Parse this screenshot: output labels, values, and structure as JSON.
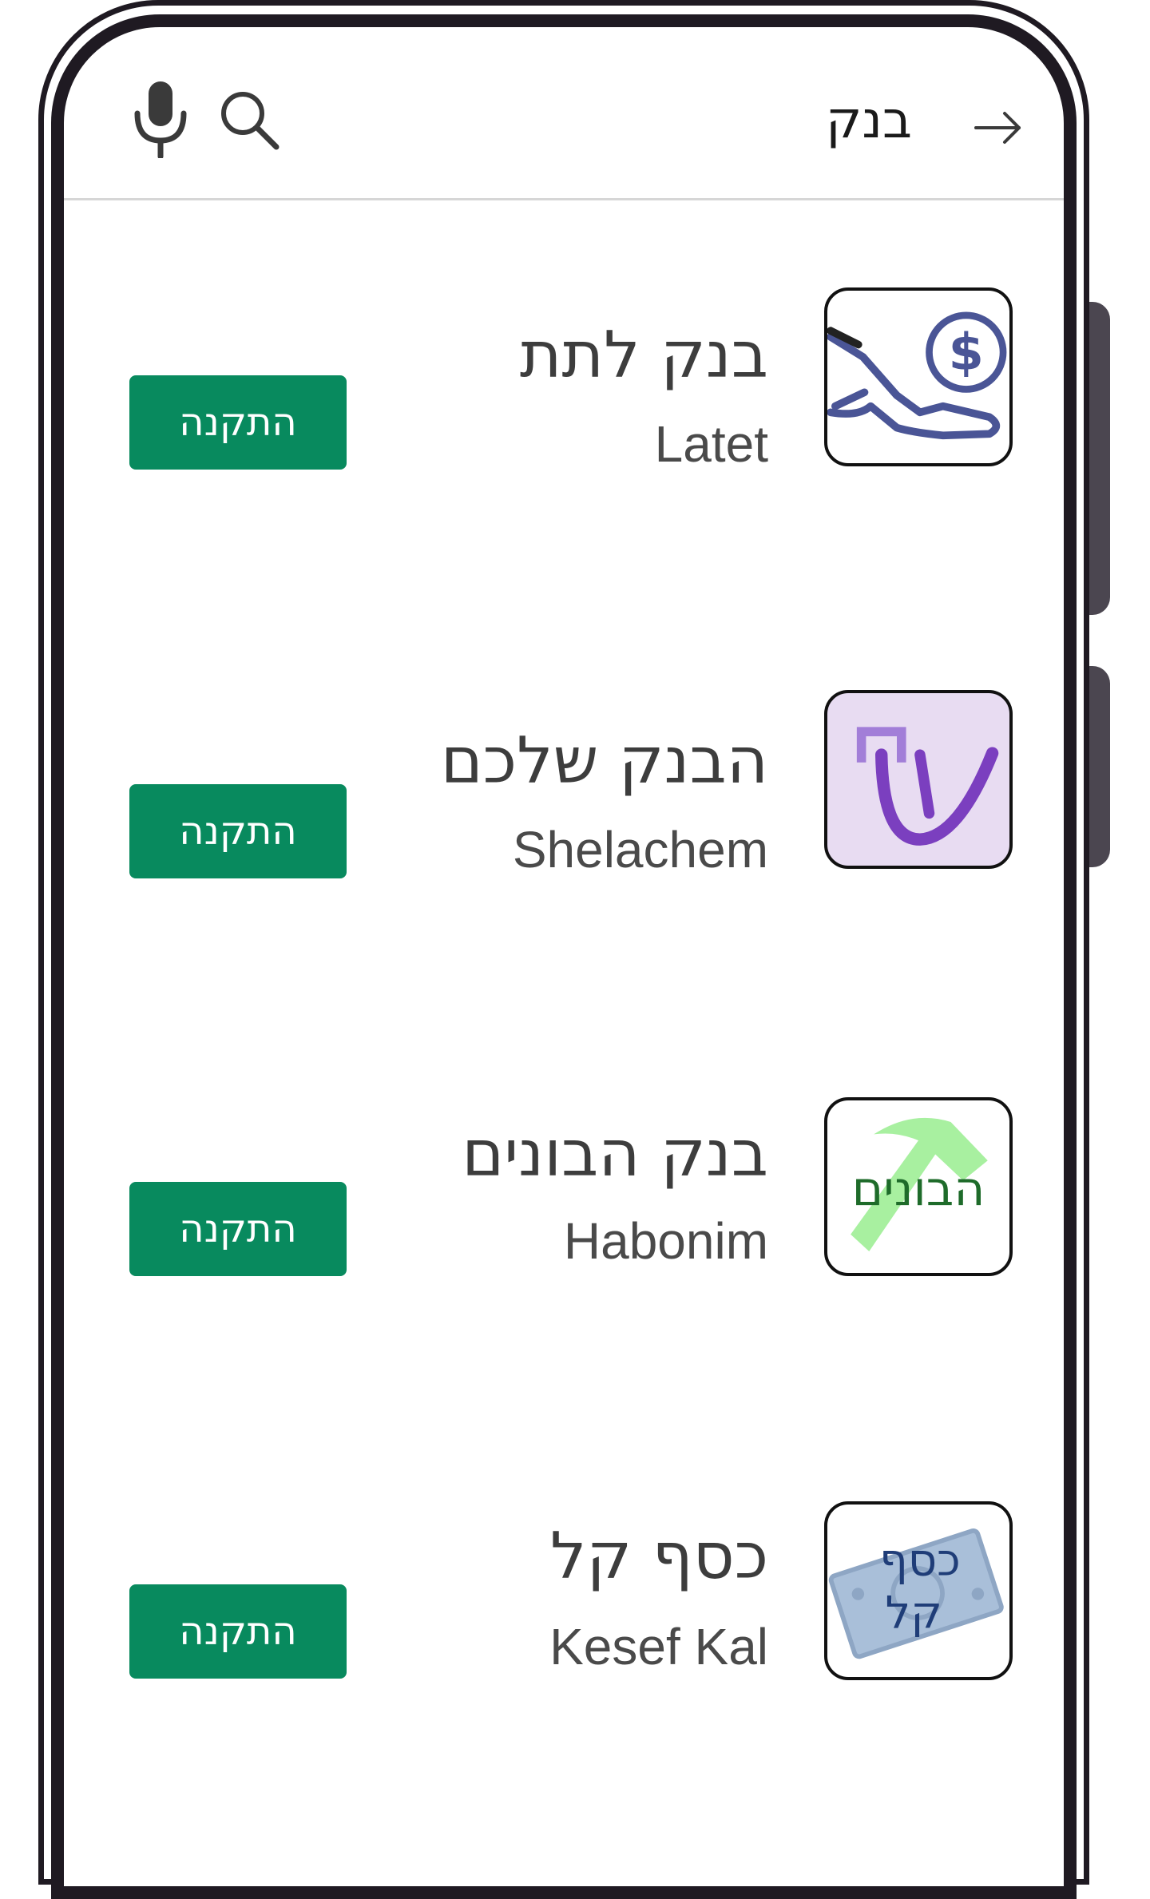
{
  "search": {
    "query": "בנק",
    "mic_icon": "mic-icon",
    "search_icon": "search-icon",
    "back_icon": "arrow-right-icon"
  },
  "colors": {
    "install_button": "#088a5e",
    "frame": "#1f1a22",
    "side_button": "#4b4650",
    "latet_icon": "#4a5596",
    "shelachem_bg": "#e8dcf2",
    "shelachem_fg": "#7b3fbf",
    "habonim_text": "#1e6b2a",
    "habonim_hammer": "#a8f0a0",
    "keseflogo_text": "#1f3d78",
    "keseflogo_bill": "#a9bfd9"
  },
  "apps": [
    {
      "name": "בנק לתת",
      "subtitle": "Latet",
      "install_label": "התקנה",
      "icon": "hand-coin-icon"
    },
    {
      "name": "הבנק שלכם",
      "subtitle": "Shelachem",
      "install_label": "התקנה",
      "icon": "shin-logo-icon"
    },
    {
      "name": "בנק הבונים",
      "subtitle": "Habonim",
      "install_label": "התקנה",
      "icon": "habonim-hammer-icon",
      "icon_text": "הבונים"
    },
    {
      "name": "כסף קל",
      "subtitle": "Kesef Kal",
      "install_label": "התקנה",
      "icon": "banknote-icon",
      "icon_text_line1": "כסף",
      "icon_text_line2": "קל"
    }
  ]
}
